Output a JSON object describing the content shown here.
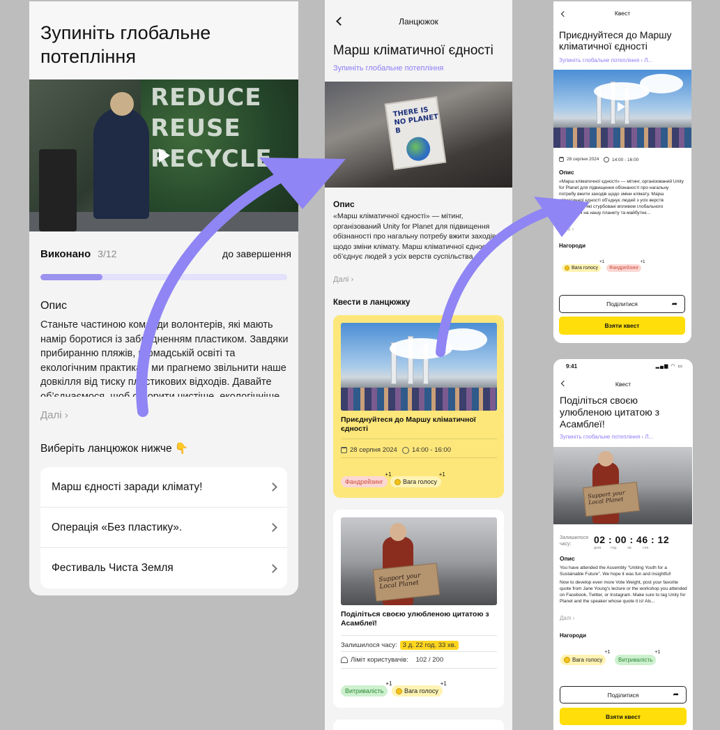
{
  "screen1": {
    "title": "Зупиніть глобальне потепління",
    "video_wall": [
      "REDUCE",
      "REUSE",
      "RECYCLE"
    ],
    "progress_label": "Виконано",
    "progress_count": "3/12",
    "progress_end": "до завершення",
    "progress_fraction": 0.25,
    "desc_heading": "Опис",
    "description": "Станьте частиною команди волонтерів, які мають намір боротися із забрудненням пластиком. Завдяки прибиранню пляжів, громадській освіті та екологічним практикам ми прагнемо звільнити наше довкілля від тиску пластикових відходів. Давайте об’єднаємося, щоб створити чистіше, екологічніше майбутнє для...",
    "more_label": "Далі",
    "choose_label": "Виберіть ланцюжок нижче 👇",
    "chains": [
      "Марш єдності заради клімату!",
      "Операція «Без пластику».",
      "Фестиваль Чиста Земля"
    ]
  },
  "screen2": {
    "nav_title": "Ланцюжок",
    "title": "Марш кліматичної єдності",
    "subtitle": "Зупиніть глобальне потепління",
    "sign_text": "THERE IS NO PLANET B",
    "desc_heading": "Опис",
    "description": "«Марш кліматичної єдності» — мітинг, організований Unity for Planet для підвищення обізнаності про нагальну потребу вжити заходів щодо зміни клімату. Марш кліматичної єдності об’єднує людей з усіх верств суспільства, які стурбовані впливом глобального потепління на нашу планету та май...",
    "more_label": "Далі",
    "quests_heading": "Квести в ланцюжку",
    "card1": {
      "title": "Приєднуйтеся до Маршу кліматичної єдності",
      "date": "28 серпня 2024",
      "time": "14:00 - 16:00",
      "badge1": "Фандрейзинг",
      "badge2": "Вага голосу",
      "plus": "+1"
    },
    "card2": {
      "title": "Поділіться своєю улюбленою цитатою з Асамблеї!",
      "sign_text": "Support your Local Planet",
      "remaining_label": "Залишилося часу:",
      "remaining_value": "3 д. 22 год. 33 хв.",
      "limit_label": "Ліміт користувачів:",
      "limit_value": "102 / 200",
      "badge1": "Витривалість",
      "badge2": "Вага голосу",
      "plus": "+1"
    }
  },
  "screen3": {
    "nav_title": "Квест",
    "title": "Приєднуйтеся до Маршу кліматичної єдності",
    "breadcrumb": "Зупиніть глобальне потепління",
    "breadcrumb_more": "Л...",
    "date": "28 серпня 2024",
    "time": "14:00 - 16:00",
    "desc_heading": "Опис",
    "description": "«Марш кліматичної єдності» — мітинг, організований Unity for Planet для підвищення обізнаності про нагальну потребу вжити заходів щодо зміни клімату. Марш кліматичної єдності об’єднує людей з усіх верств суспільства, які стурбовані впливом глобального потепління на нашу планету та майбутнє...",
    "more_label": "Далі",
    "rewards_heading": "Нагороди",
    "badge1": "Вага голосу",
    "badge2": "Фандрейзинг",
    "plus": "+1",
    "share_label": "Поділитися",
    "take_label": "Взяти квест"
  },
  "screen4": {
    "status_time": "9:41",
    "status_icons": "▂▄▆ ◠ ▭",
    "nav_title": "Квест",
    "title": "Поділіться своєю улюбленою цитатою з Асамблеї!",
    "breadcrumb": "Зупиніть глобальне потепління",
    "breadcrumb_more": "Л...",
    "sign_text": "Support your Local Planet",
    "timer_label": "Залишилося часу:",
    "timer": "02 : 00 : 46 : 12",
    "timer_units": [
      "днів",
      "год.",
      "хв.",
      "сек."
    ],
    "desc_heading": "Опис",
    "description_p1": "You have attended the Assembly \"Uniting Youth for a Sustainable Future\". We hope it was fun and insightful!",
    "description_p2": "Now to develop even more Vote Weight, post your favorite quote from Jane Young's lecture or the workshop you attended on Facebook, Twitter, or Instagram. Make sure to tag Unity for Planet and the speaker whose quote it is! Als...",
    "more_label": "Далі",
    "rewards_heading": "Нагороди",
    "badge1": "Вага голосу",
    "badge2": "Витривалість",
    "plus": "+1",
    "share_label": "Поділитися",
    "take_label": "Взяти квест"
  },
  "colors": {
    "accent": "#8b7cf6",
    "arrow": "#8f85f4",
    "yellow": "#ffde0a",
    "card_yellow": "#fde77a"
  }
}
